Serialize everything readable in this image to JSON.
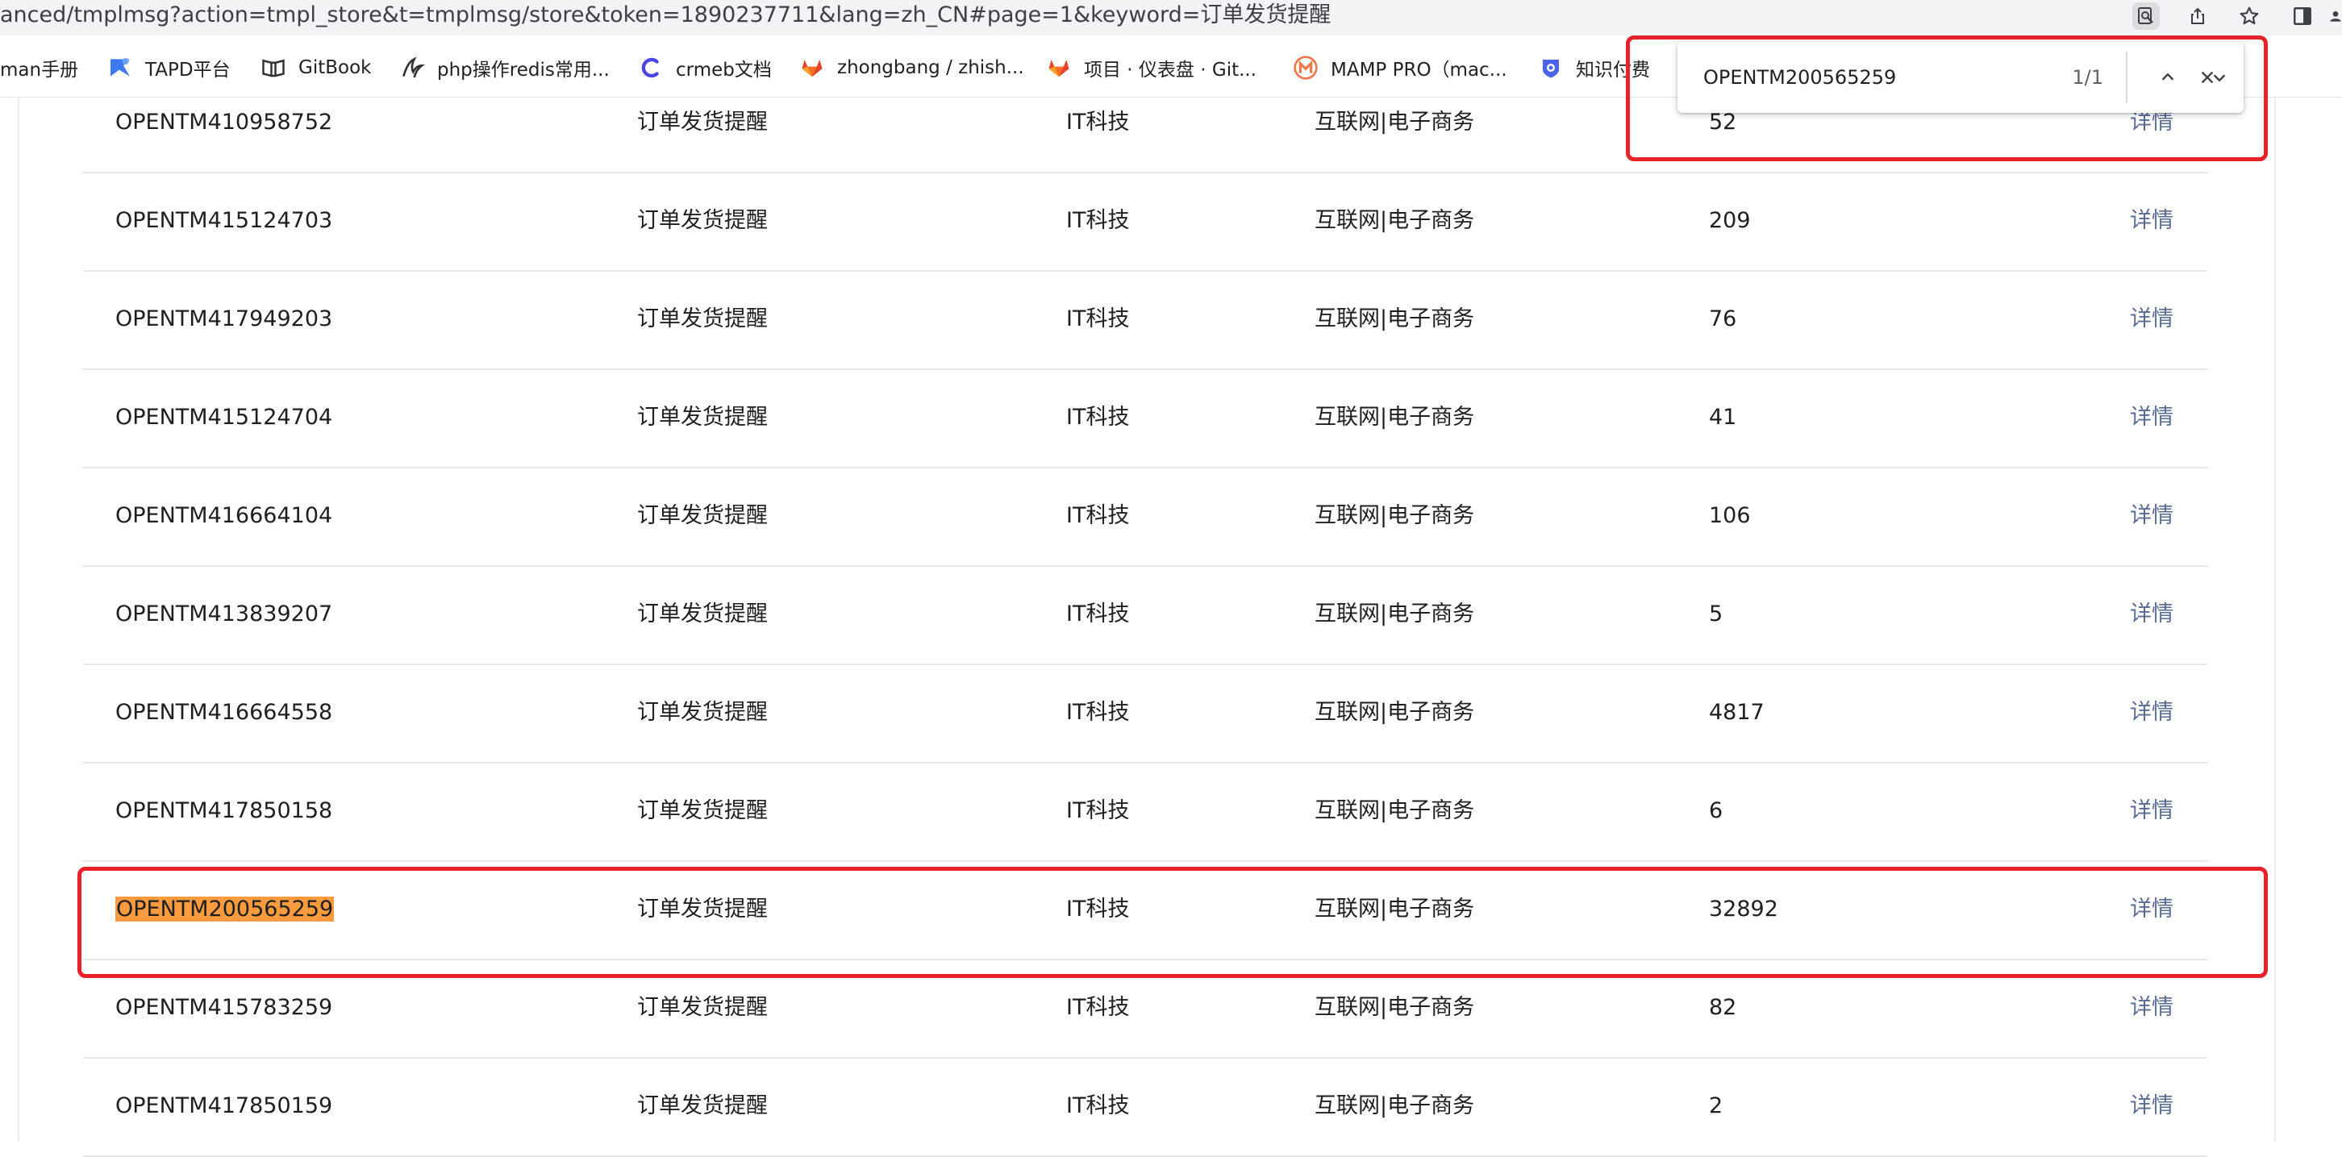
{
  "browser": {
    "url": "anced/tmplmsg?action=tmpl_store&t=tmplmsg/store&token=1890237711&lang=zh_CN#page=1&keyword=订单发货提醒",
    "icons": [
      "find-in-page-icon",
      "share-icon",
      "star-icon",
      "side-panel-icon",
      "profile-icon"
    ]
  },
  "bookmarks": [
    {
      "label": "man手册",
      "icon": "none"
    },
    {
      "label": "TAPD平台",
      "icon": "tapd-icon"
    },
    {
      "label": "GitBook",
      "icon": "gitbook-icon"
    },
    {
      "label": "php操作redis常用...",
      "icon": "php-icon"
    },
    {
      "label": "crmeb文档",
      "icon": "crmeb-icon"
    },
    {
      "label": "zhongbang / zhish...",
      "icon": "gitlab-icon"
    },
    {
      "label": "项目 · 仪表盘 · Git...",
      "icon": "gitlab-icon"
    },
    {
      "label": "MAMP PRO（mac...",
      "icon": "mamp-icon"
    },
    {
      "label": "知识付费",
      "icon": "knowledge-icon"
    }
  ],
  "findbar": {
    "query": "OPENTM200565259",
    "count": "1/1"
  },
  "table": {
    "link_label": "详情",
    "rows": [
      {
        "id": "OPENTM410958752",
        "title": "订单发货提醒",
        "industry": "IT科技",
        "sub": "互联网|电子商务",
        "count": "52"
      },
      {
        "id": "OPENTM415124703",
        "title": "订单发货提醒",
        "industry": "IT科技",
        "sub": "互联网|电子商务",
        "count": "209"
      },
      {
        "id": "OPENTM417949203",
        "title": "订单发货提醒",
        "industry": "IT科技",
        "sub": "互联网|电子商务",
        "count": "76"
      },
      {
        "id": "OPENTM415124704",
        "title": "订单发货提醒",
        "industry": "IT科技",
        "sub": "互联网|电子商务",
        "count": "41"
      },
      {
        "id": "OPENTM416664104",
        "title": "订单发货提醒",
        "industry": "IT科技",
        "sub": "互联网|电子商务",
        "count": "106"
      },
      {
        "id": "OPENTM413839207",
        "title": "订单发货提醒",
        "industry": "IT科技",
        "sub": "互联网|电子商务",
        "count": "5"
      },
      {
        "id": "OPENTM416664558",
        "title": "订单发货提醒",
        "industry": "IT科技",
        "sub": "互联网|电子商务",
        "count": "4817"
      },
      {
        "id": "OPENTM417850158",
        "title": "订单发货提醒",
        "industry": "IT科技",
        "sub": "互联网|电子商务",
        "count": "6"
      },
      {
        "id": "OPENTM200565259",
        "title": "订单发货提醒",
        "industry": "IT科技",
        "sub": "互联网|电子商务",
        "count": "32892"
      },
      {
        "id": "OPENTM415783259",
        "title": "订单发货提醒",
        "industry": "IT科技",
        "sub": "互联网|电子商务",
        "count": "82"
      },
      {
        "id": "OPENTM417850159",
        "title": "订单发货提醒",
        "industry": "IT科技",
        "sub": "互联网|电子商务",
        "count": "2"
      }
    ]
  },
  "colors": {
    "link": "#576b95",
    "highlight": "#f99b3e",
    "annotation": "#e8212b"
  }
}
